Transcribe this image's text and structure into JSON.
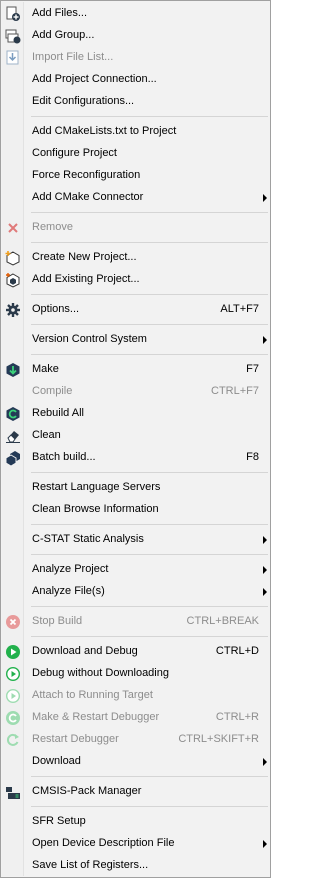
{
  "menu": {
    "items": [
      {
        "label": "Add Files...",
        "icon": "add-files-icon"
      },
      {
        "label": "Add Group...",
        "icon": "add-group-icon"
      },
      {
        "label": "Import File List...",
        "icon": "import-file-list-icon",
        "disabled": true
      },
      {
        "label": "Add Project Connection..."
      },
      {
        "label": "Edit Configurations..."
      },
      {
        "label": "Add CMakeLists.txt to Project"
      },
      {
        "label": "Configure Project"
      },
      {
        "label": "Force Reconfiguration"
      },
      {
        "label": "Add CMake Connector",
        "submenu": true
      },
      {
        "label": "Remove",
        "icon": "remove-x-icon",
        "disabled": true
      },
      {
        "label": "Create New Project...",
        "icon": "create-project-icon"
      },
      {
        "label": "Add Existing Project...",
        "icon": "add-existing-project-icon"
      },
      {
        "label": "Options...",
        "icon": "gear-icon",
        "shortcut": "ALT+F7"
      },
      {
        "label": "Version Control System",
        "submenu": true
      },
      {
        "label": "Make",
        "icon": "make-icon",
        "shortcut": "F7"
      },
      {
        "label": "Compile",
        "shortcut": "CTRL+F7",
        "disabled": true
      },
      {
        "label": "Rebuild All",
        "icon": "rebuild-all-icon"
      },
      {
        "label": "Clean",
        "icon": "clean-eraser-icon"
      },
      {
        "label": "Batch build...",
        "icon": "batch-build-icon",
        "shortcut": "F8"
      },
      {
        "label": "Restart Language Servers"
      },
      {
        "label": "Clean Browse Information"
      },
      {
        "label": "C-STAT Static Analysis",
        "submenu": true
      },
      {
        "label": "Analyze Project",
        "submenu": true
      },
      {
        "label": "Analyze File(s)",
        "submenu": true
      },
      {
        "label": "Stop Build",
        "icon": "stop-build-icon",
        "shortcut": "CTRL+BREAK",
        "disabled": true
      },
      {
        "label": "Download and Debug",
        "icon": "download-debug-icon",
        "shortcut": "CTRL+D"
      },
      {
        "label": "Debug without Downloading",
        "icon": "debug-no-download-icon"
      },
      {
        "label": "Attach to Running Target",
        "icon": "attach-target-icon",
        "disabled": true
      },
      {
        "label": "Make & Restart Debugger",
        "icon": "make-restart-debugger-icon",
        "shortcut": "CTRL+R",
        "disabled": true
      },
      {
        "label": "Restart Debugger",
        "icon": "restart-debugger-icon",
        "shortcut": "CTRL+SKIFT+R",
        "disabled": true
      },
      {
        "label": "Download",
        "submenu": true
      },
      {
        "label": "CMSIS-Pack Manager",
        "icon": "cmsis-pack-manager-icon"
      },
      {
        "label": "SFR Setup"
      },
      {
        "label": "Open Device Description File",
        "submenu": true
      },
      {
        "label": "Save List of Registers..."
      }
    ]
  }
}
